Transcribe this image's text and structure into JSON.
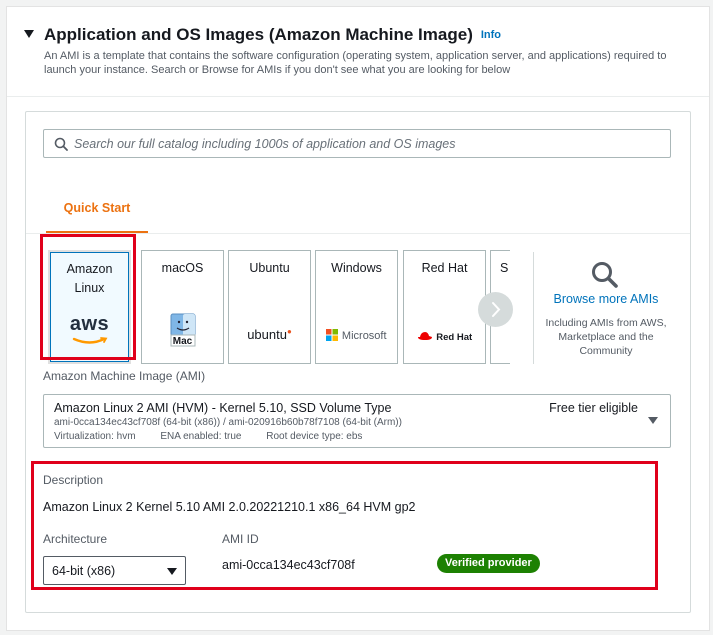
{
  "section": {
    "title": "Application and OS Images (Amazon Machine Image)",
    "info_label": "Info",
    "description": "An AMI is a template that contains the software configuration (operating system, application server, and applications) required to launch your instance. Search or Browse for AMIs if you don't see what you are looking for below"
  },
  "search": {
    "placeholder": "Search our full catalog including 1000s of application and OS images",
    "value": ""
  },
  "tabs": [
    {
      "label": "Quick Start",
      "selected": true
    }
  ],
  "tiles": [
    {
      "label_line1": "Amazon",
      "label_line2": "Linux",
      "logo": "aws",
      "icon": "aws-logo-icon",
      "selected": true
    },
    {
      "label_line1": "macOS",
      "label_line2": "",
      "logo": "Mac",
      "icon": "apple-mac-icon",
      "selected": false
    },
    {
      "label_line1": "Ubuntu",
      "label_line2": "",
      "logo": "ubuntu",
      "icon": "ubuntu-logo-icon",
      "selected": false
    },
    {
      "label_line1": "Windows",
      "label_line2": "",
      "logo": "Microsoft",
      "icon": "microsoft-logo-icon",
      "selected": false
    },
    {
      "label_line1": "Red Hat",
      "label_line2": "",
      "logo": "Red Hat",
      "icon": "redhat-logo-icon",
      "selected": false
    },
    {
      "label_line1": "S",
      "label_line2": "",
      "logo": "",
      "icon": "",
      "selected": false
    }
  ],
  "browse": {
    "link_label": "Browse more AMIs",
    "subtext": "Including AMIs from AWS, Marketplace and the Community"
  },
  "ami_select": {
    "label": "Amazon Machine Image (AMI)",
    "name": "Amazon Linux 2 AMI (HVM) - Kernel 5.10, SSD Volume Type",
    "tier": "Free tier eligible",
    "ids": "ami-0cca134ec43cf708f (64-bit (x86)) / ami-020916b60b78f7108 (64-bit (Arm))",
    "virtualization": "Virtualization: hvm",
    "ena": "ENA enabled: true",
    "root_device": "Root device type: ebs"
  },
  "details": {
    "description_label": "Description",
    "description_value": "Amazon Linux 2 Kernel 5.10 AMI 2.0.20221210.1 x86_64 HVM gp2",
    "architecture_label": "Architecture",
    "architecture_value": "64-bit (x86)",
    "ami_id_label": "AMI ID",
    "ami_id_value": "ami-0cca134ec43cf708f",
    "verified_badge": "Verified provider"
  },
  "colors": {
    "accent": "#ec7211",
    "link": "#0073bb",
    "highlight": "#e0001b",
    "badge": "#1d8102"
  }
}
